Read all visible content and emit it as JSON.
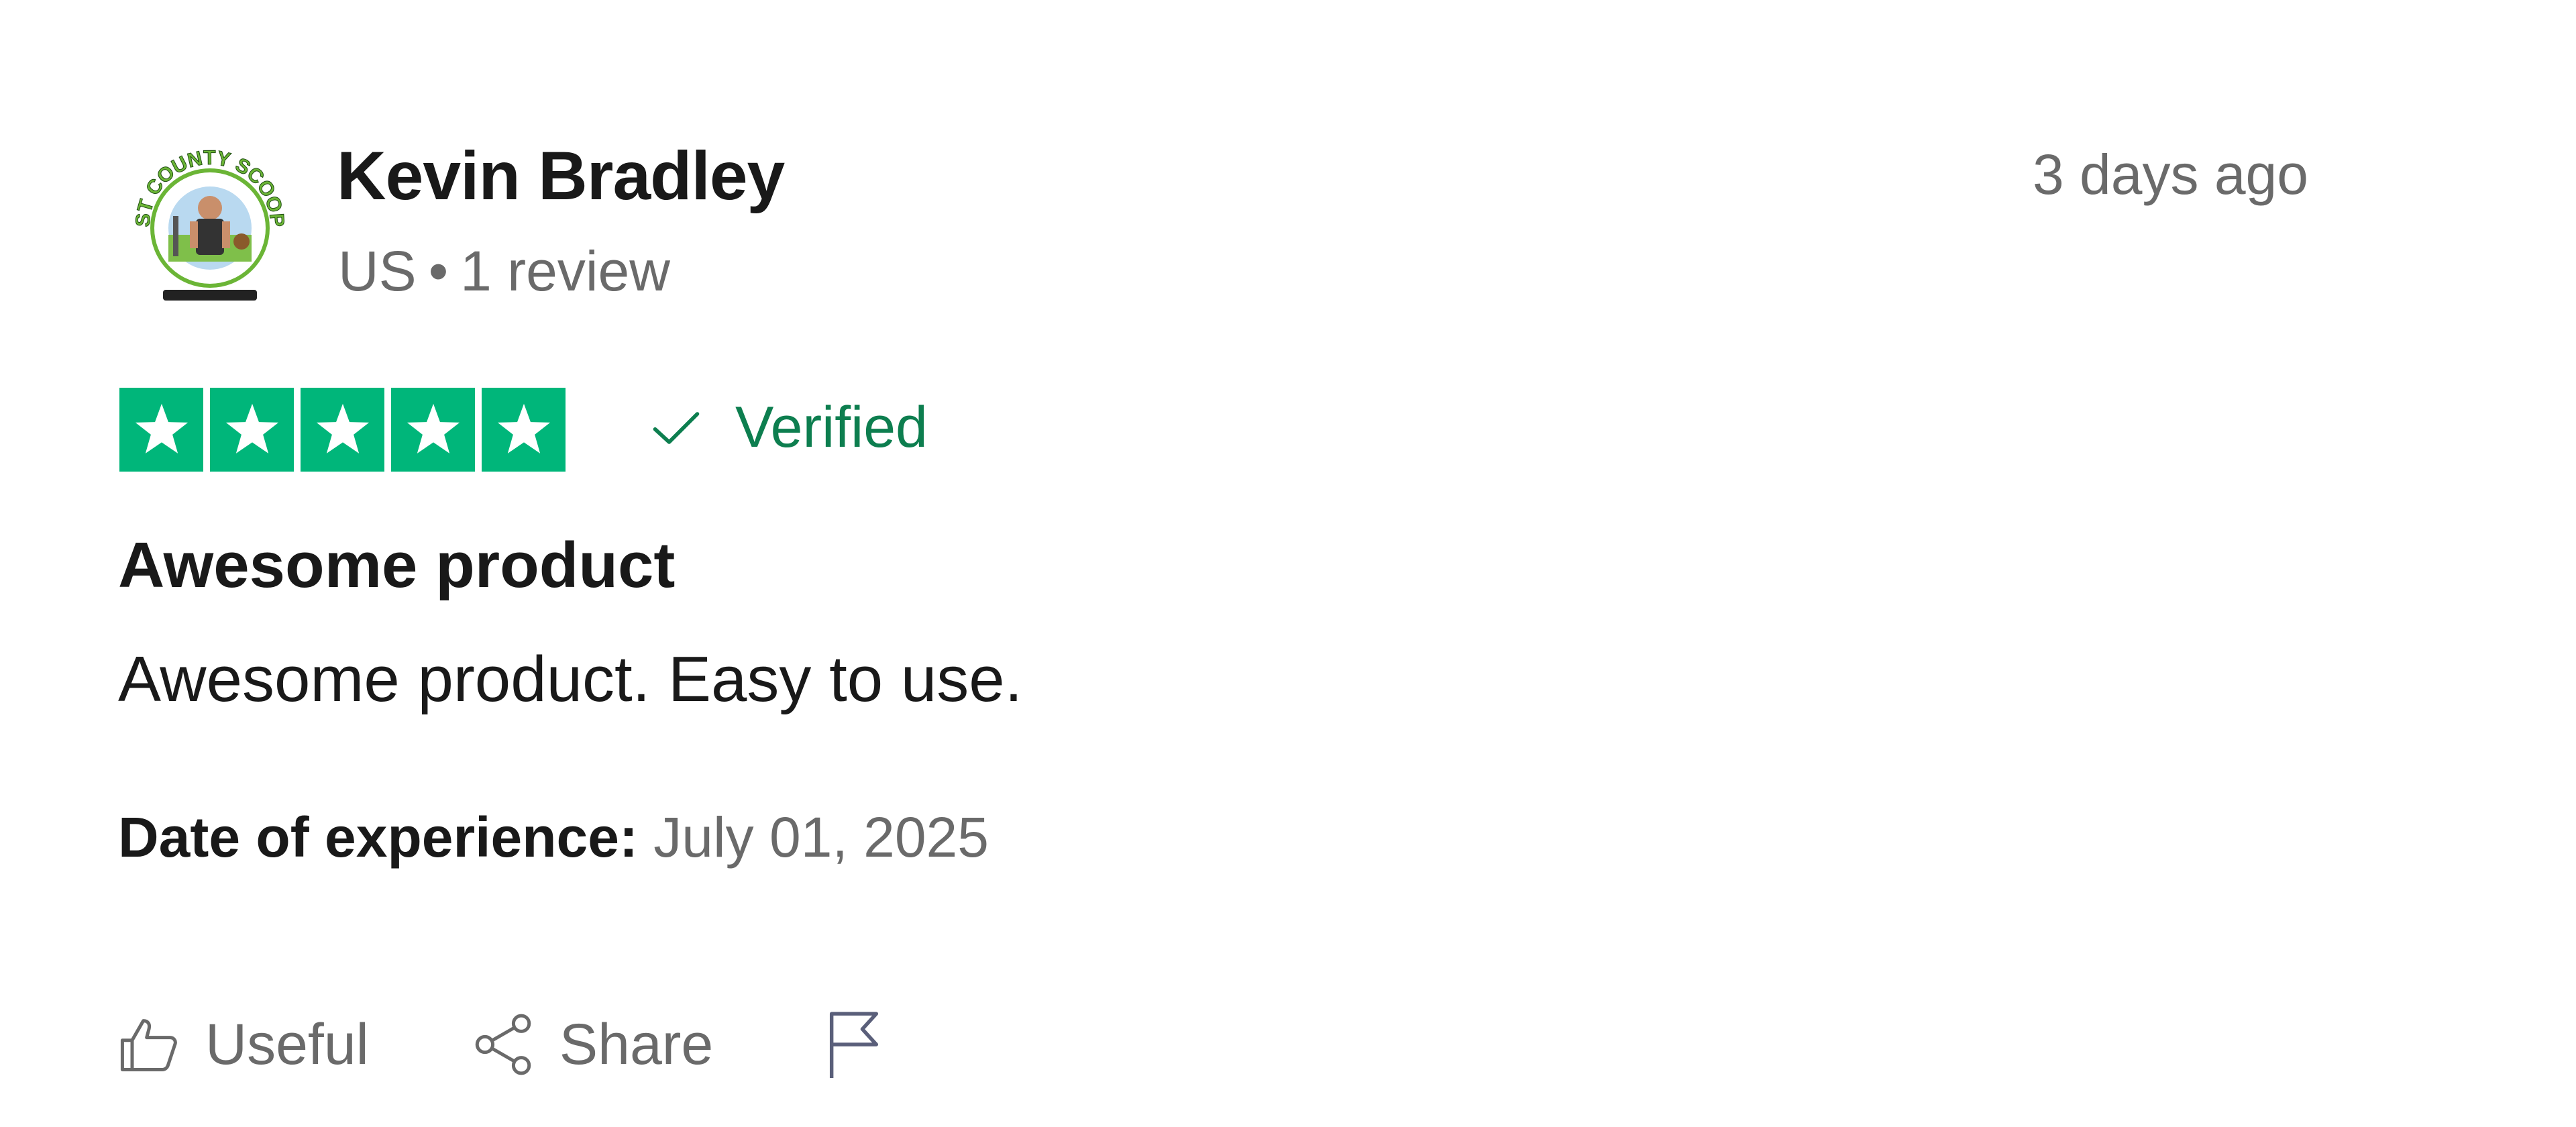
{
  "reviewer": {
    "name": "Kevin Bradley",
    "country": "US",
    "separator": "•",
    "review_count": "1 review",
    "avatar_icon": "company-logo-avatar",
    "avatar_logo_text": "EAST COUNTY SCOOPER"
  },
  "review": {
    "posted": "3 days ago",
    "rating": 5,
    "rating_max": 5,
    "verified_label": "Verified",
    "title": "Awesome product",
    "body": "Awesome product. Easy to use.",
    "experience_label": "Date of experience:",
    "experience_date": "July 01, 2025"
  },
  "actions": {
    "useful_label": "Useful",
    "share_label": "Share",
    "useful_icon": "thumbs-up-icon",
    "share_icon": "share-icon",
    "report_icon": "flag-icon"
  },
  "colors": {
    "star_green": "#00b67a",
    "verified_green": "#0d7e4f",
    "text_dark": "#191919",
    "text_muted": "#6a6a6a",
    "logo_green": "#6bb536"
  }
}
